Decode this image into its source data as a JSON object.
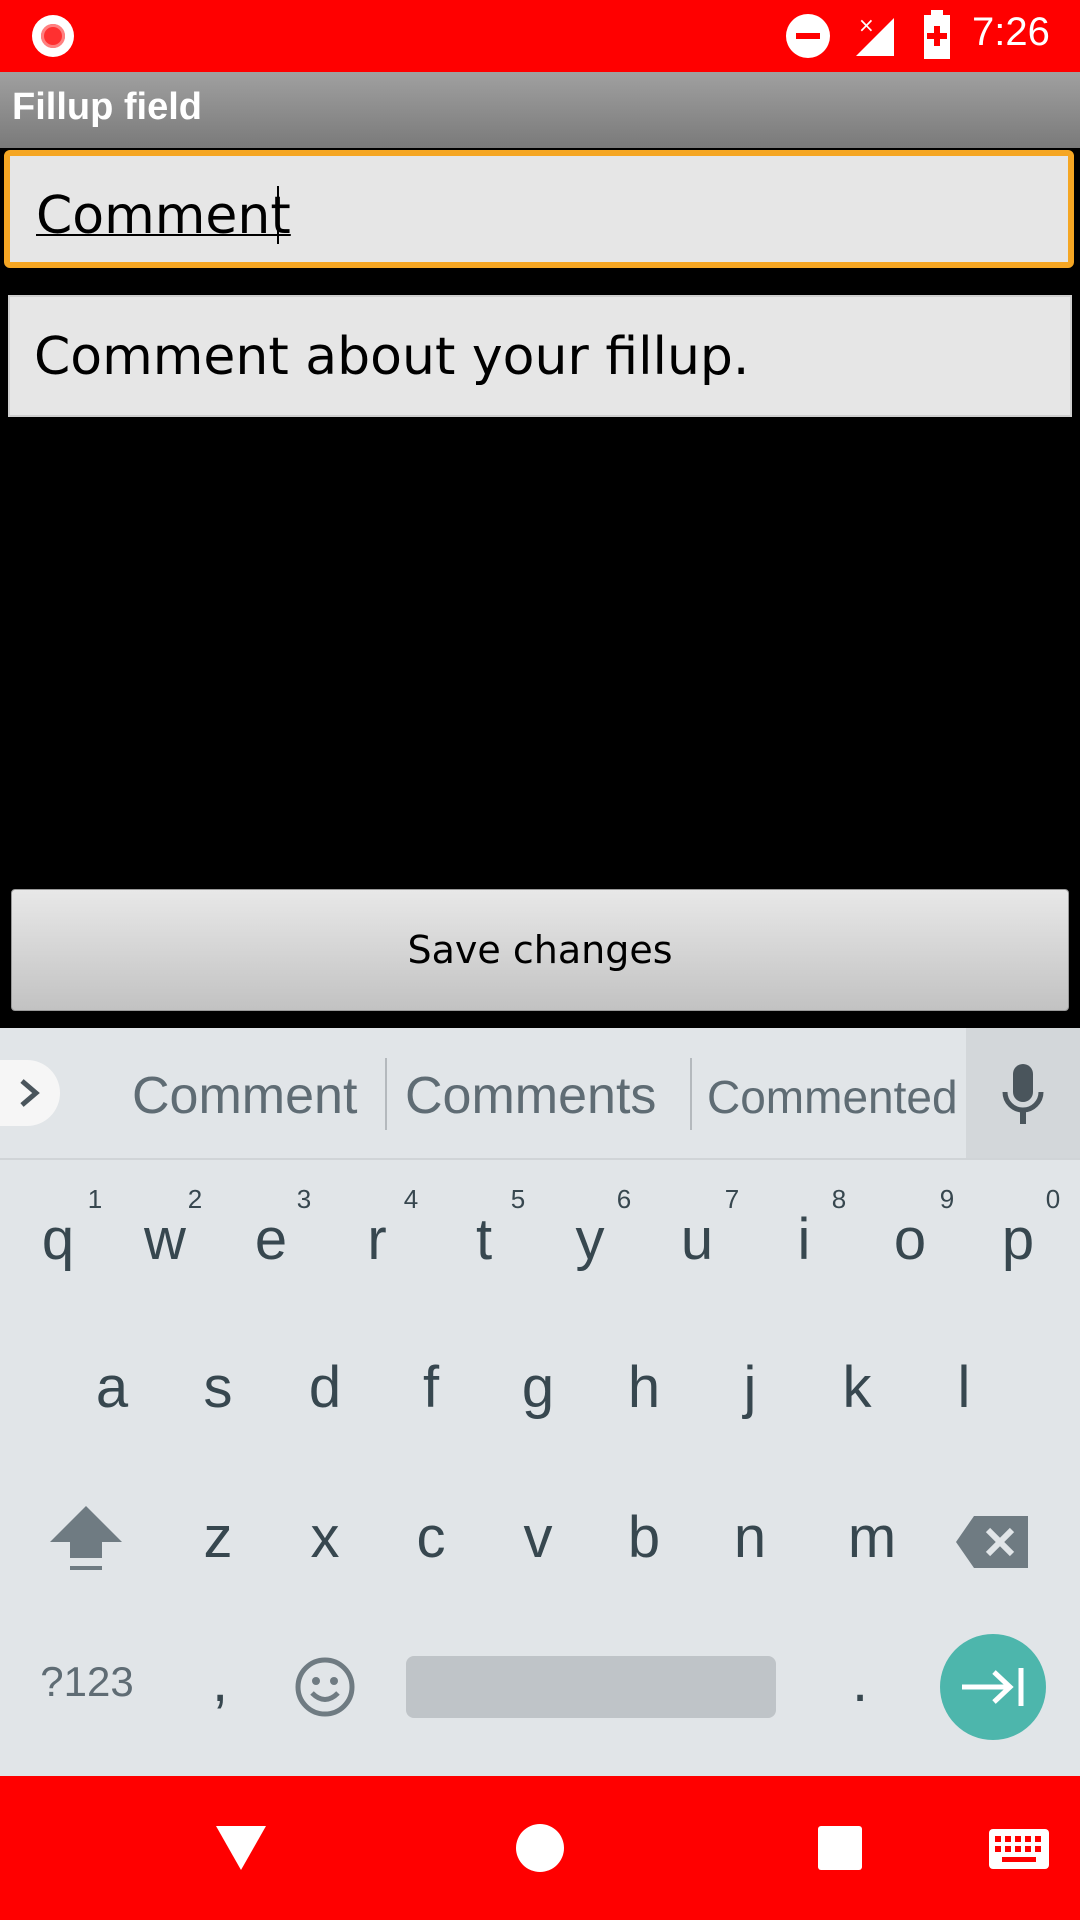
{
  "status_bar": {
    "time": "7:26"
  },
  "app": {
    "title": "Fillup field"
  },
  "form": {
    "name_field_value": "Comment",
    "description_field_value": "Comment about your fillup.",
    "save_label": "Save changes"
  },
  "keyboard": {
    "suggestions": [
      "Comment",
      "Comments",
      "Commented"
    ],
    "row1": [
      "q",
      "w",
      "e",
      "r",
      "t",
      "y",
      "u",
      "i",
      "o",
      "p"
    ],
    "row1_hints": [
      "1",
      "2",
      "3",
      "4",
      "5",
      "6",
      "7",
      "8",
      "9",
      "0"
    ],
    "row2": [
      "a",
      "s",
      "d",
      "f",
      "g",
      "h",
      "j",
      "k",
      "l"
    ],
    "row3": [
      "z",
      "x",
      "c",
      "v",
      "b",
      "n",
      "m"
    ],
    "symbols_label": "?123",
    "comma_label": ",",
    "period_label": "."
  }
}
